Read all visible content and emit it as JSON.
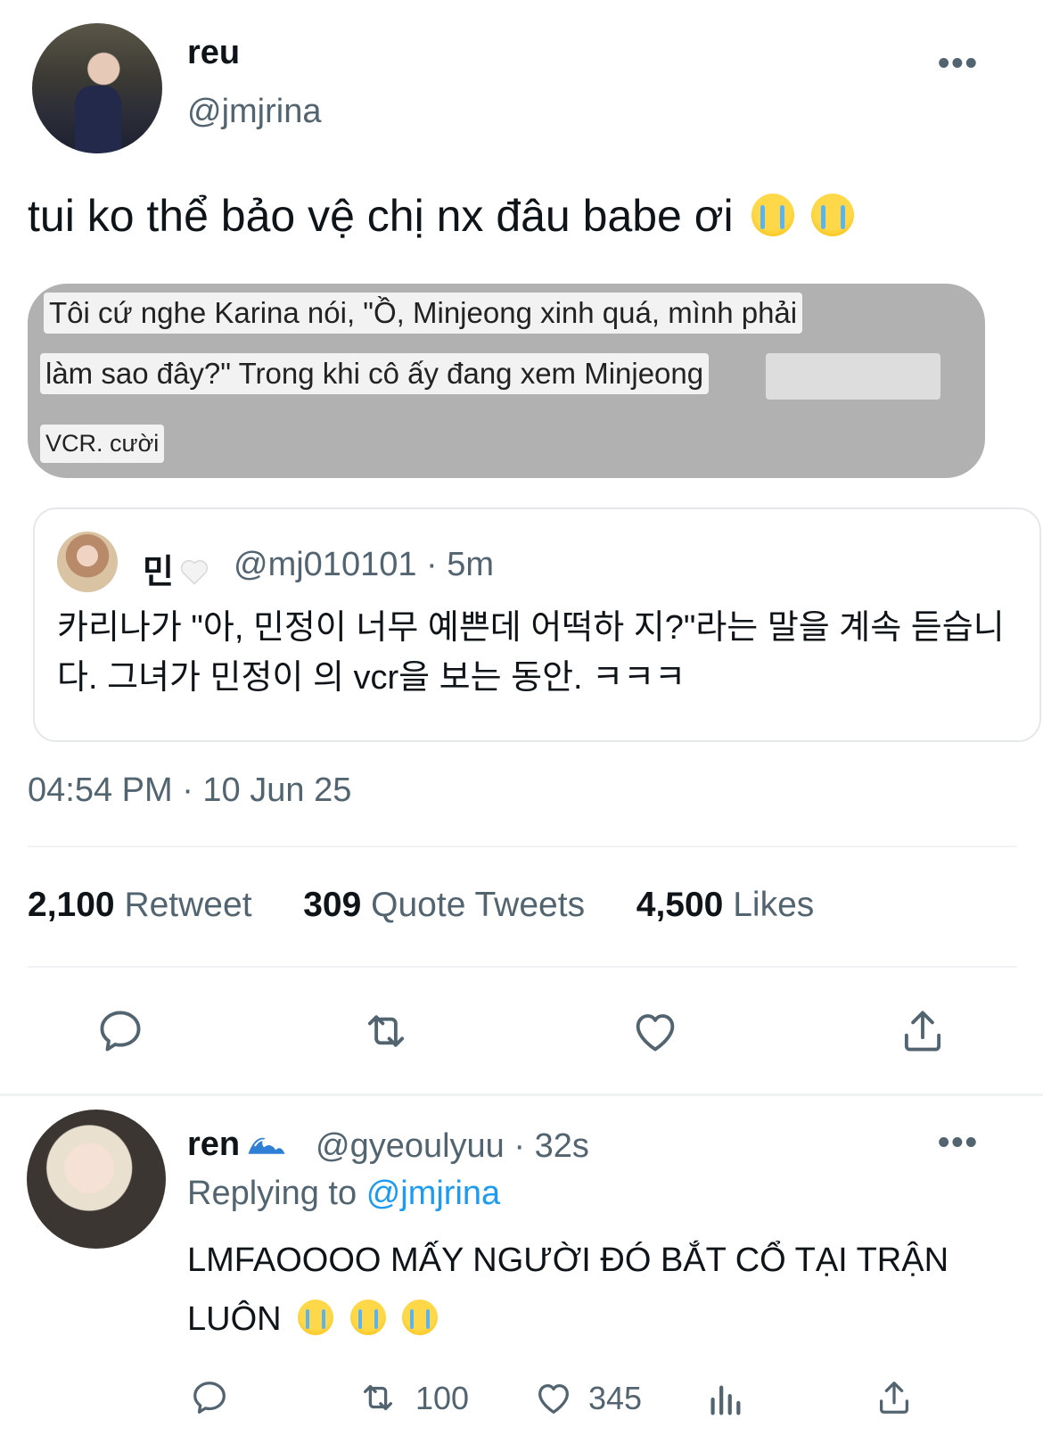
{
  "tweet": {
    "author_name": "reu",
    "author_handle": "@jmjrina",
    "more_label": "•••",
    "text": "tui ko thể bảo vệ chị nx đâu babe ơi",
    "emojis": [
      "loudly-crying-face",
      "loudly-crying-face"
    ],
    "image_captions": {
      "line1": "Tôi cứ nghe Karina nói, \"Ồ, Minjeong xinh quá, mình phải",
      "line2": "làm sao đây?\" Trong khi cô ấy đang xem Minjeong",
      "line3": "VCR. cười"
    },
    "quote": {
      "name": "민",
      "handle_time": "@mj010101 · 5m",
      "text": "카리나가 \"아, 민정이 너무 예쁜데 어떡하 지?\"라는 말을 계속 듣습니다. 그녀가 민정이 의 vcr을 보는 동안. ㅋㅋㅋ"
    },
    "timestamp": "04:54 PM · 10 Jun 25",
    "stats": {
      "retweets": "2,100",
      "retweets_label": "Retweet",
      "quotes": "309",
      "quotes_label": "Quote Tweets",
      "likes": "4,500",
      "likes_label": "Likes"
    }
  },
  "reply": {
    "author_name": "ren",
    "author_handle_time": "@gyeoulyuu · 32s",
    "replying_prefix": "Replying to",
    "replying_to": "@jmjrina",
    "text": "LMFAOOOO MẤY NGƯỜI ĐÓ BẮT CỔ TẠI TRẬN LUÔN",
    "emojis": [
      "loudly-crying-face",
      "loudly-crying-face",
      "loudly-crying-face"
    ],
    "retweet_count": "100",
    "like_count": "345"
  },
  "colors": {
    "text": "#0f1419",
    "secondary": "#536471",
    "link": "#1d9bf0",
    "divider": "#eff3f4"
  }
}
